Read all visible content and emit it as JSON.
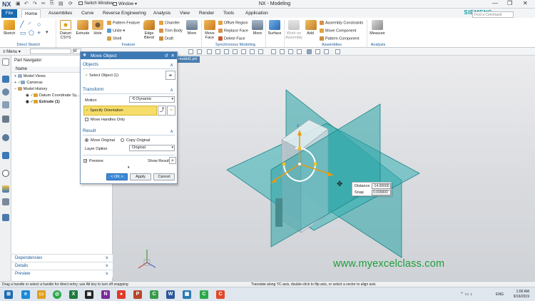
{
  "window": {
    "app_logo": "NX",
    "title": "NX - Modeling",
    "switch_window": "Switch Window",
    "window_menu": "Window",
    "brand": "SIEMENS",
    "search_placeholder": "Find a Command",
    "controls": [
      "—",
      "❐",
      "✕"
    ]
  },
  "tabs": [
    "File",
    "Home",
    "Assemblies",
    "Curve",
    "Reverse Engineering",
    "Analysis",
    "View",
    "Render",
    "Tools",
    "Application"
  ],
  "ribbon": {
    "sketch": "Sketch",
    "datum_csys": "Datum CSYS",
    "extrude": "Extrude",
    "hole": "Hole",
    "pattern_feature": "Pattern Feature",
    "unite": "Unite",
    "shell": "Shell",
    "edge_blend": "Edge Blend",
    "chamfer": "Chamfer",
    "trim_body": "Trim Body",
    "draft": "Draft",
    "more": "More",
    "move_face": "Move Face",
    "offset_region": "Offset Region",
    "replace_face": "Replace Face",
    "delete_face": "Delete Face",
    "surface": "Surface",
    "work_on_assembly": "Work on Assembly",
    "add": "Add",
    "assembly_constraints": "Assembly Constraints",
    "move_component": "Move Component",
    "pattern_component": "Pattern Component",
    "measure": "Measure",
    "groups": [
      "Direct Sketch",
      "Feature",
      "Synchronous Modeling",
      "Assemblies",
      "Analysis"
    ]
  },
  "toolbar": {
    "menu": "Menu",
    "filter2": "W"
  },
  "part_navigator": {
    "title": "Part Navigator",
    "column": "Name",
    "items": [
      "Model Views",
      "Cameras",
      "Model History",
      "Datum Coordinate Sy...",
      "Extrude (1)"
    ],
    "sections": [
      "Dependencies",
      "Details",
      "Preview"
    ]
  },
  "doc_tab": "model1.prt",
  "dialog": {
    "title": "Move Object",
    "objects_section": "Objects",
    "select_object": "Select Object (1)",
    "transform_section": "Transform",
    "motion_label": "Motion",
    "motion_value": "Dynamic",
    "specify_orientation": "Specify Orientation",
    "move_handles_only": "Move Handles Only",
    "result_section": "Result",
    "move_original": "Move Original",
    "copy_original": "Copy Original",
    "layer_option_label": "Layer Option",
    "layer_option_value": "Original",
    "preview": "Preview",
    "show_result": "Show Result",
    "ok": "< OK >",
    "apply": "Apply",
    "cancel": "Cancel"
  },
  "distance_popup": {
    "distance_label": "Distance",
    "distance_value": "-14.00000",
    "snap_label": "Snap",
    "snap_value": "0.000000"
  },
  "watermark": "www.myexcelclass.com",
  "status": {
    "left": "Drag a handle or select a handle for direct entry; use Alt key to turn off snapping",
    "right": "Translate along YC-axis, double-click to flip axis, or select a vector to align axis"
  },
  "taskbar": {
    "lang": "ENG",
    "time": "1:06 AM",
    "date": "9/16/2019"
  }
}
